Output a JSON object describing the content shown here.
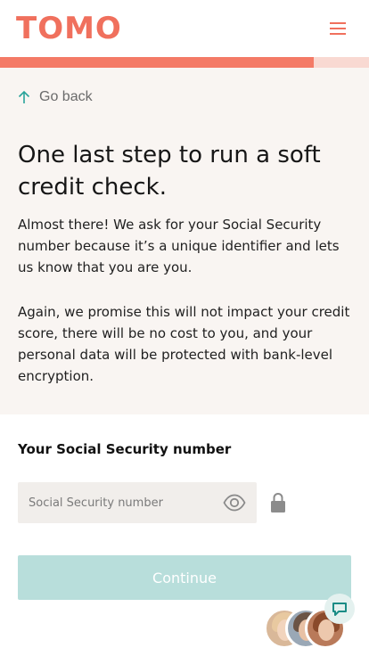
{
  "header": {
    "logo_text": "TOMO",
    "brand_color": "#f0705d",
    "menu_icon": "hamburger-menu-icon"
  },
  "progress": {
    "fraction": 0.85,
    "fill_color": "#f47a66",
    "track_color": "#f9d9d2"
  },
  "nav": {
    "go_back_label": "Go back",
    "go_back_icon": "arrow-up-icon"
  },
  "intro": {
    "headline": "One last step to run a soft credit check.",
    "paragraph_1": "Almost there! We ask for your Social Security number because it’s a unique identifier and lets us know that you are you.",
    "paragraph_2": "Again, we promise this will not impact your credit score, there will be no cost to you, and your personal data will be protected with bank-level encryption."
  },
  "form": {
    "ssn_label": "Your Social Security number",
    "ssn_placeholder": "Social Security number",
    "ssn_value": "",
    "reveal_icon": "eye-icon",
    "lock_icon": "lock-icon",
    "continue_label": "Continue",
    "continue_color": "#b8dedb"
  },
  "chat": {
    "chat_icon": "chat-bubble-icon",
    "avatars": [
      "support-agent-1",
      "support-agent-2",
      "support-agent-3"
    ]
  }
}
